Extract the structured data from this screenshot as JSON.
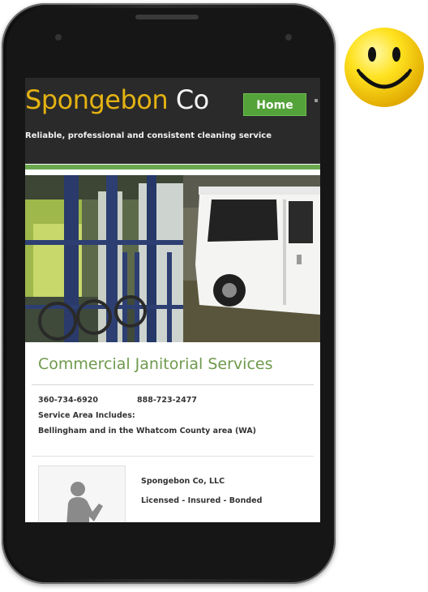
{
  "site": {
    "brand_name": "Spongebon",
    "brand_suffix": "Co",
    "nav_home": "Home",
    "tagline": "Reliable, professional and consistent cleaning service"
  },
  "content": {
    "title": "Commercial Janitorial Services",
    "phone_1": "360-734-6920",
    "phone_2": "888-723-2477",
    "service_label": "Service Area Includes:",
    "service_area": "Bellingham and in the Whatcom County area (WA)"
  },
  "company": {
    "name": "Spongebon Co, LLC",
    "tagline": "Licensed - Insured - Bonded"
  },
  "colors": {
    "brand_yellow": "#e4b312",
    "nav_green": "#54a23a",
    "title_green": "#6f9a4c",
    "header_dark": "#2a2a2a"
  },
  "icons": {
    "smiley": "smiley-face-icon",
    "avatar": "person-silhouette-icon"
  }
}
